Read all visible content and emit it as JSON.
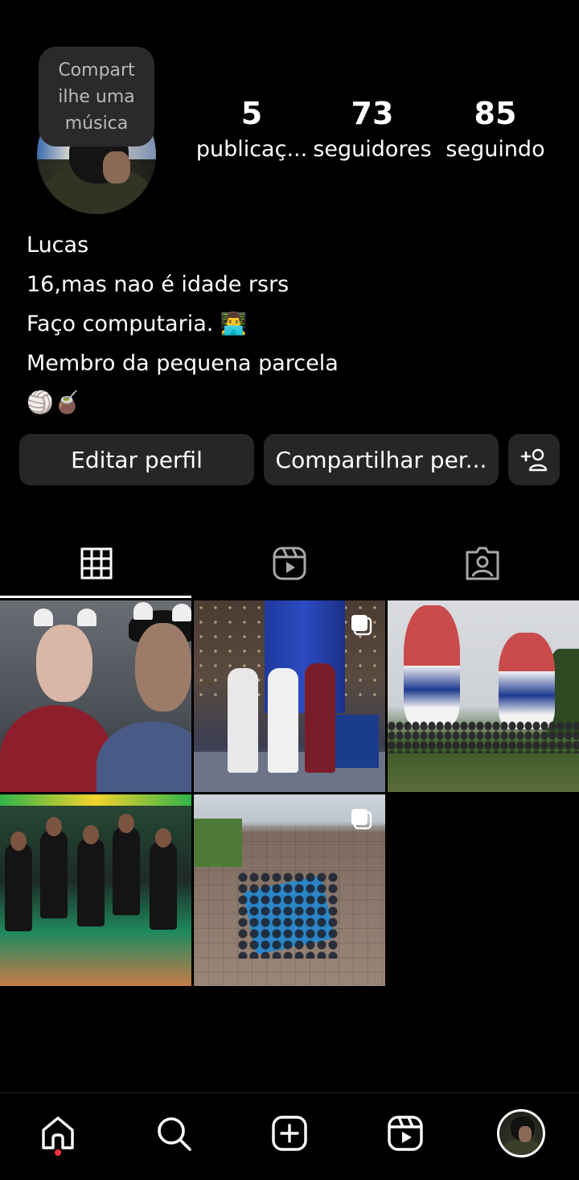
{
  "profile": {
    "note_text": "Compart ilhe uma música",
    "stats": [
      {
        "value": "5",
        "label": "publicaç..."
      },
      {
        "value": "73",
        "label": "seguidores"
      },
      {
        "value": "85",
        "label": "seguindo"
      }
    ],
    "name": "Lucas",
    "bio": [
      "16,mas nao é idade rsrs",
      "Faço computaria. 👨‍💻",
      "Membro da pequena parcela",
      "🏐🧉"
    ]
  },
  "actions": {
    "edit_label": "Editar perfil",
    "share_label": "Compartilhar per..."
  },
  "tabs": [
    {
      "icon": "grid-icon",
      "selected": true
    },
    {
      "icon": "reels-icon",
      "selected": false
    },
    {
      "icon": "tagged-icon",
      "selected": false
    }
  ],
  "posts": [
    {
      "name": "post-1",
      "multiple": false
    },
    {
      "name": "post-2",
      "multiple": true
    },
    {
      "name": "post-3",
      "multiple": false
    },
    {
      "name": "post-4",
      "multiple": false
    },
    {
      "name": "post-5",
      "multiple": true
    }
  ],
  "bottom_nav": [
    {
      "icon": "home-icon",
      "has_notification_dot": true
    },
    {
      "icon": "search-icon"
    },
    {
      "icon": "create-icon"
    },
    {
      "icon": "reels-icon"
    },
    {
      "icon": "profile-avatar"
    }
  ],
  "colors": {
    "background": "#000000",
    "button": "#262626",
    "notification_dot": "#ff3040"
  }
}
